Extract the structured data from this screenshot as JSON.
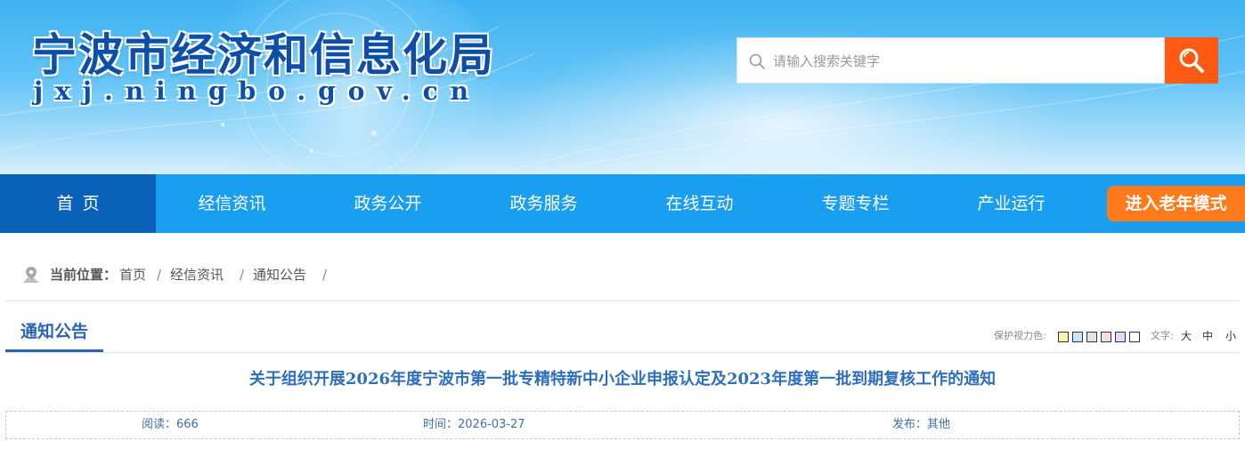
{
  "header": {
    "site_title": "宁波市经济和信息化局",
    "site_domain": "jxj.ningbo.gov.cn",
    "search": {
      "placeholder": "请输入搜索关键字",
      "icon": "search-icon",
      "button_icon": "magnifier-icon"
    }
  },
  "nav": {
    "items": [
      {
        "label": "首页",
        "active": true
      },
      {
        "label": "经信资讯"
      },
      {
        "label": "政务公开"
      },
      {
        "label": "政务服务"
      },
      {
        "label": "在线互动"
      },
      {
        "label": "专题专栏"
      },
      {
        "label": "产业运行"
      }
    ],
    "elder_mode_label": "进入老年模式"
  },
  "breadcrumb": {
    "icon": "location-icon",
    "label": "当前位置：",
    "items": [
      "首页",
      "经信资讯",
      "通知公告"
    ],
    "separator": "/"
  },
  "section": {
    "tab_label": "通知公告"
  },
  "view_tools": {
    "color_label": "保护视力色:",
    "swatches": [
      "#fdf2b0",
      "#c8e4f6",
      "#e3e3e3",
      "#f5dde6",
      "#e6d6f5",
      "#ffffff"
    ],
    "font_label": "文字:",
    "font_sizes": [
      "大",
      "中",
      "小"
    ]
  },
  "article": {
    "title": "关于组织开展2026年度宁波市第一批专精特新中小企业申报认定及2023年度第一批到期复核工作的通知",
    "meta": {
      "reads": "阅读：666",
      "time": "时间：2026-03-27",
      "publisher": "发布：其他"
    }
  },
  "colors": {
    "nav_bg": "#1a9ff0",
    "nav_active": "#0a62b8",
    "elder_button": "#ff7a1a",
    "search_button": "#ff5a14",
    "title_blue": "#2e6fbd"
  }
}
